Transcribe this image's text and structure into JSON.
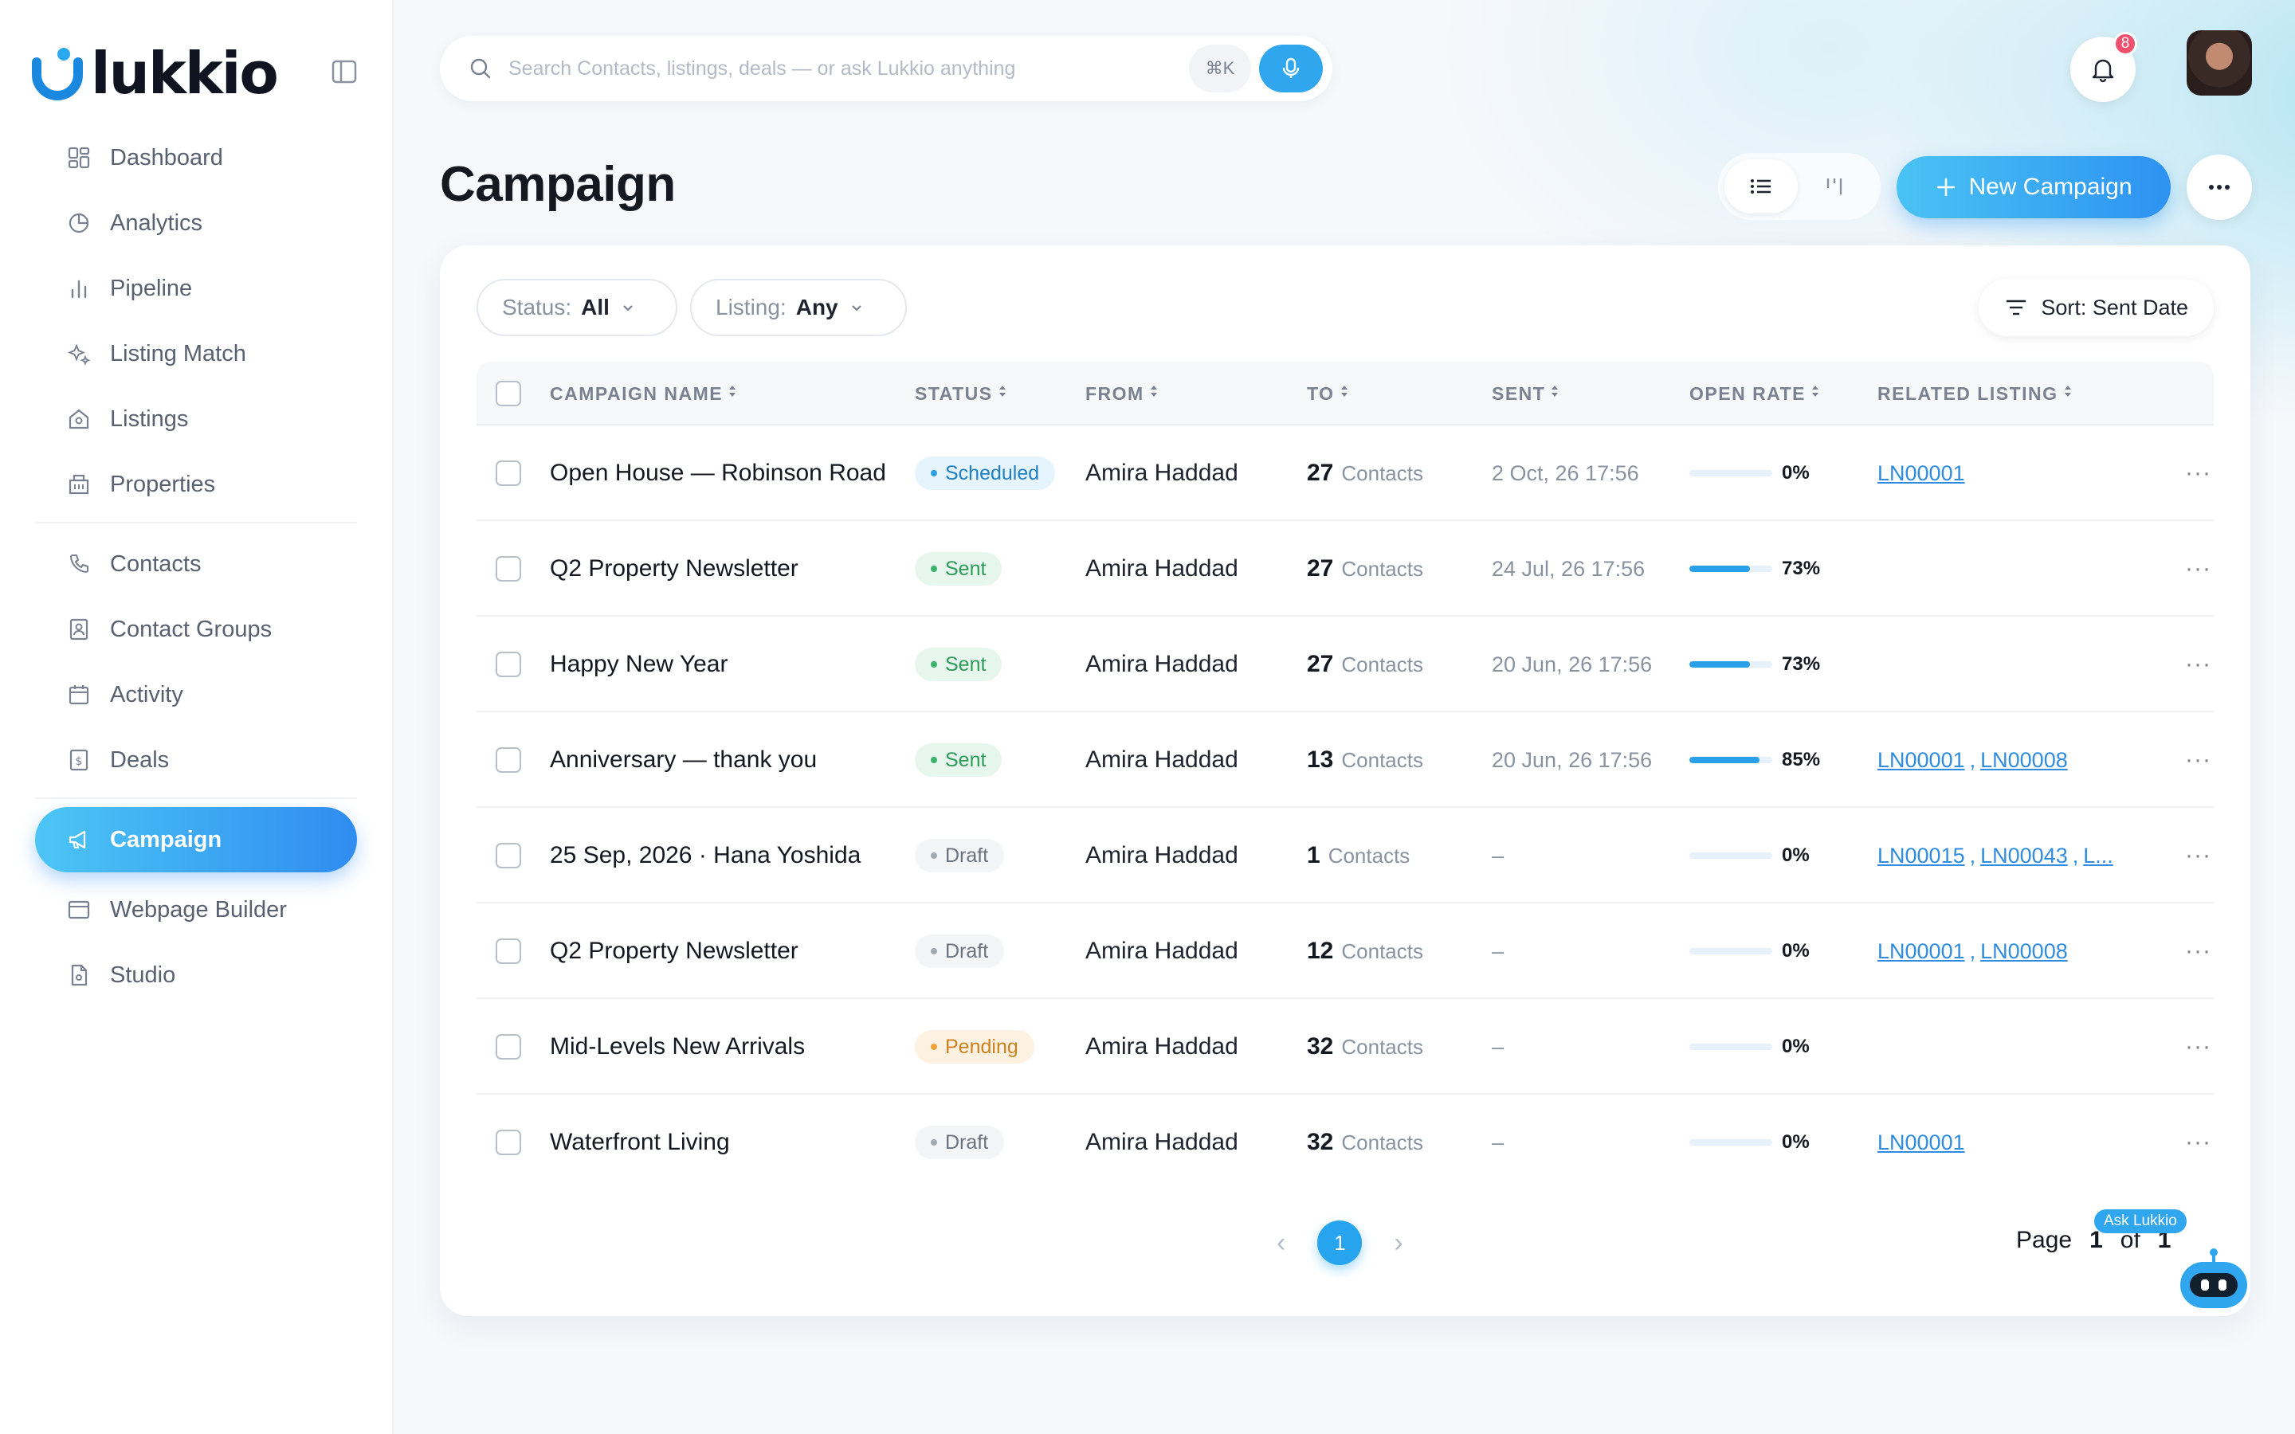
{
  "app": {
    "name": "lukkio"
  },
  "search": {
    "placeholder": "Search Contacts, listings, deals — or ask Lukkio anything",
    "shortcut": "⌘K"
  },
  "notifications": {
    "count": "8"
  },
  "sidebar": {
    "group1": [
      {
        "label": "Dashboard",
        "icon": "dashboard-icon"
      },
      {
        "label": "Analytics",
        "icon": "pie-chart-icon"
      },
      {
        "label": "Pipeline",
        "icon": "bar-chart-icon"
      },
      {
        "label": "Listing Match",
        "icon": "sparkles-icon"
      },
      {
        "label": "Listings",
        "icon": "home-icon"
      },
      {
        "label": "Properties",
        "icon": "building-icon"
      }
    ],
    "group2": [
      {
        "label": "Contacts",
        "icon": "phone-icon"
      },
      {
        "label": "Contact Groups",
        "icon": "contact-card-icon"
      },
      {
        "label": "Activity",
        "icon": "calendar-icon"
      },
      {
        "label": "Deals",
        "icon": "dollar-doc-icon"
      }
    ],
    "active": {
      "label": "Campaign",
      "icon": "megaphone-icon"
    },
    "group3": [
      {
        "label": "Webpage Builder",
        "icon": "browser-icon"
      },
      {
        "label": "Studio",
        "icon": "file-icon"
      }
    ]
  },
  "page": {
    "title": "Campaign",
    "new_button": "New Campaign"
  },
  "filters": {
    "status_label": "Status:",
    "status_value": "All",
    "listing_label": "Listing:",
    "listing_value": "Any",
    "sort": "Sort: Sent Date"
  },
  "columns": [
    "CAMPAIGN NAME",
    "STATUS",
    "FROM",
    "TO",
    "SENT",
    "OPEN RATE",
    "RELATED LISTING"
  ],
  "status_colors": {
    "Scheduled": {
      "bg": "#e6f4fd",
      "fg": "#1f7fc4",
      "dot": "#2a9fe8"
    },
    "Sent": {
      "bg": "#e8f7ee",
      "fg": "#2f9a5a",
      "dot": "#3cb36b"
    },
    "Draft": {
      "bg": "#f4f5f7",
      "fg": "#6b7280",
      "dot": "#a3a9b4"
    },
    "Pending": {
      "bg": "#fdf1e1",
      "fg": "#c9821f",
      "dot": "#f0a33a"
    }
  },
  "rows": [
    {
      "name": "Open House — Robinson Road",
      "status": "Scheduled",
      "from": "Amira Haddad",
      "to": "27",
      "to_label": "Contacts",
      "sent": "2 Oct, 26 17:56",
      "open_rate": "0%",
      "open_value": 0,
      "listings": [
        "LN00001"
      ]
    },
    {
      "name": "Q2 Property Newsletter",
      "status": "Sent",
      "from": "Amira Haddad",
      "to": "27",
      "to_label": "Contacts",
      "sent": "24 Jul, 26 17:56",
      "open_rate": "73%",
      "open_value": 73,
      "listings": []
    },
    {
      "name": "Happy New Year",
      "status": "Sent",
      "from": "Amira Haddad",
      "to": "27",
      "to_label": "Contacts",
      "sent": "20 Jun, 26 17:56",
      "open_rate": "73%",
      "open_value": 73,
      "listings": []
    },
    {
      "name": "Anniversary — thank you",
      "status": "Sent",
      "from": "Amira Haddad",
      "to": "13",
      "to_label": "Contacts",
      "sent": "20 Jun, 26 17:56",
      "open_rate": "85%",
      "open_value": 85,
      "listings": [
        "LN00001",
        "LN00008"
      ]
    },
    {
      "name": "25 Sep, 2026 · Hana Yoshida",
      "status": "Draft",
      "from": "Amira Haddad",
      "to": "1",
      "to_label": "Contacts",
      "sent": "–",
      "open_rate": "0%",
      "open_value": 0,
      "listings": [
        "LN00015",
        "LN00043",
        "L..."
      ]
    },
    {
      "name": "Q2 Property Newsletter",
      "status": "Draft",
      "from": "Amira Haddad",
      "to": "12",
      "to_label": "Contacts",
      "sent": "–",
      "open_rate": "0%",
      "open_value": 0,
      "listings": [
        "LN00001",
        "LN00008"
      ]
    },
    {
      "name": "Mid-Levels New Arrivals",
      "status": "Pending",
      "from": "Amira Haddad",
      "to": "32",
      "to_label": "Contacts",
      "sent": "–",
      "open_rate": "0%",
      "open_value": 0,
      "listings": []
    },
    {
      "name": "Waterfront Living",
      "status": "Draft",
      "from": "Amira Haddad",
      "to": "32",
      "to_label": "Contacts",
      "sent": "–",
      "open_rate": "0%",
      "open_value": 0,
      "listings": [
        "LN00001"
      ]
    }
  ],
  "pagination": {
    "current": "1",
    "page_label": "Page",
    "page": "1",
    "of_label": "of",
    "total": "1"
  },
  "assistant": {
    "tag": "Ask Lukkio"
  }
}
